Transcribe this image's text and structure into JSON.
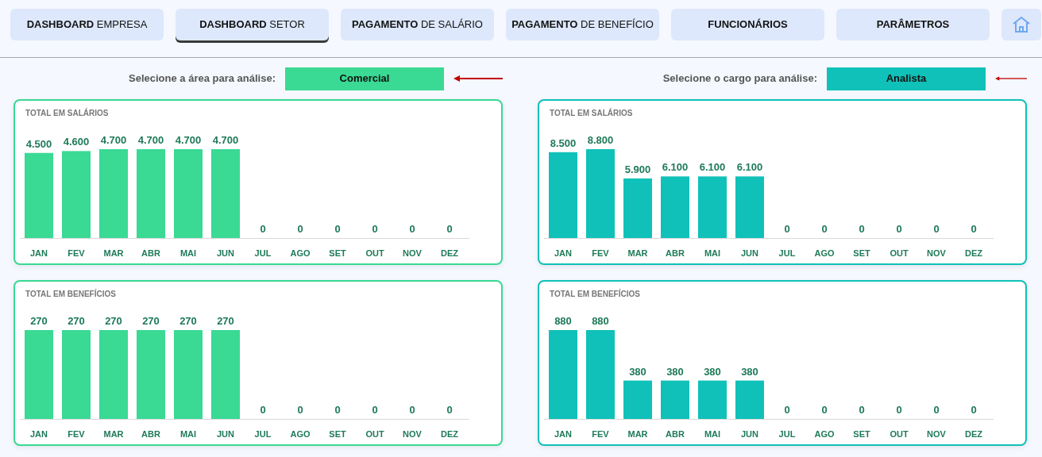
{
  "nav": [
    {
      "label": "**DASHBOARD** EMPRESA",
      "selected": false
    },
    {
      "label": "**DASHBOARD** SETOR",
      "selected": true
    },
    {
      "label": "**PAGAMENTO** DE SALÁRIO",
      "selected": false
    },
    {
      "label": "**PAGAMENTO** DE BENEFÍCIO",
      "selected": false
    },
    {
      "label": "**FUNCIONÁRIOS**",
      "selected": false
    },
    {
      "label": "**PARÂMETROS**",
      "selected": false
    }
  ],
  "panels": [
    {
      "selector": {
        "label": "Selecione a área para análise:",
        "value": "Comercial",
        "color": "#3ad994"
      },
      "charts": [
        {
          "chart_data": {
            "type": "bar",
            "title": "TOTAL EM SALÁRIOS",
            "categories": [
              "JAN",
              "FEV",
              "MAR",
              "ABR",
              "MAI",
              "JUN",
              "JUL",
              "AGO",
              "SET",
              "OUT",
              "NOV",
              "DEZ"
            ],
            "series": [
              {
                "color": "#3ad994",
                "values": [
                  4500,
                  4600,
                  4700,
                  4700,
                  4700,
                  4700,
                  0,
                  0,
                  0,
                  0,
                  0,
                  0
                ],
                "value_labels": [
                  "4.500",
                  "4.600",
                  "4.700",
                  "4.700",
                  "4.700",
                  "4.700",
                  "0",
                  "0",
                  "0",
                  "0",
                  "0",
                  "0"
                ]
              }
            ]
          }
        },
        {
          "chart_data": {
            "type": "bar",
            "title": "TOTAL EM BENEFÍCIOS",
            "categories": [
              "JAN",
              "FEV",
              "MAR",
              "ABR",
              "MAI",
              "JUN",
              "JUL",
              "AGO",
              "SET",
              "OUT",
              "NOV",
              "DEZ"
            ],
            "series": [
              {
                "color": "#3ad994",
                "values": [
                  270,
                  270,
                  270,
                  270,
                  270,
                  270,
                  0,
                  0,
                  0,
                  0,
                  0,
                  0
                ],
                "value_labels": [
                  "270",
                  "270",
                  "270",
                  "270",
                  "270",
                  "270",
                  "0",
                  "0",
                  "0",
                  "0",
                  "0",
                  "0"
                ]
              }
            ]
          }
        }
      ]
    },
    {
      "selector": {
        "label": "Selecione o cargo para análise:",
        "value": "Analista",
        "color": "#0fc1b8"
      },
      "charts": [
        {
          "chart_data": {
            "type": "bar",
            "title": "TOTAL EM SALÁRIOS",
            "categories": [
              "JAN",
              "FEV",
              "MAR",
              "ABR",
              "MAI",
              "JUN",
              "JUL",
              "AGO",
              "SET",
              "OUT",
              "NOV",
              "DEZ"
            ],
            "series": [
              {
                "color": "#0fc1b8",
                "values": [
                  8500,
                  8800,
                  5900,
                  6100,
                  6100,
                  6100,
                  0,
                  0,
                  0,
                  0,
                  0,
                  0
                ],
                "value_labels": [
                  "8.500",
                  "8.800",
                  "5.900",
                  "6.100",
                  "6.100",
                  "6.100",
                  "0",
                  "0",
                  "0",
                  "0",
                  "0",
                  "0"
                ]
              }
            ]
          }
        },
        {
          "chart_data": {
            "type": "bar",
            "title": "TOTAL EM BENEFÍCIOS",
            "categories": [
              "JAN",
              "FEV",
              "MAR",
              "ABR",
              "MAI",
              "JUN",
              "JUL",
              "AGO",
              "SET",
              "OUT",
              "NOV",
              "DEZ"
            ],
            "series": [
              {
                "color": "#0fc1b8",
                "values": [
                  880,
                  880,
                  380,
                  380,
                  380,
                  380,
                  0,
                  0,
                  0,
                  0,
                  0,
                  0
                ],
                "value_labels": [
                  "880",
                  "880",
                  "380",
                  "380",
                  "380",
                  "380",
                  "0",
                  "0",
                  "0",
                  "0",
                  "0",
                  "0"
                ]
              }
            ]
          }
        }
      ]
    }
  ]
}
